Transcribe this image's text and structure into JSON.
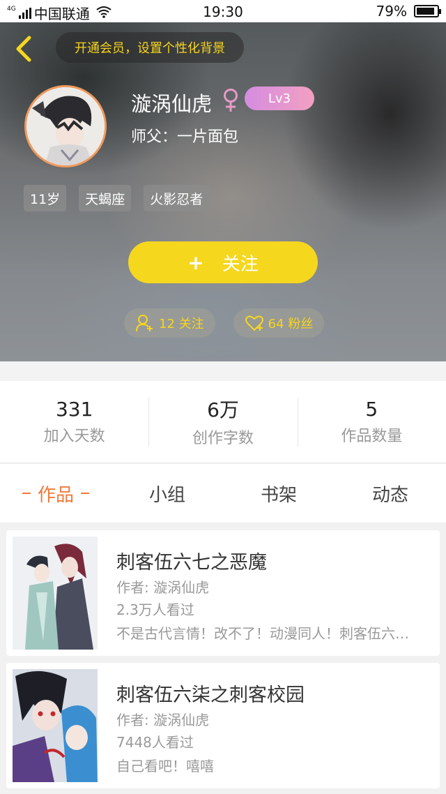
{
  "status_bar": {
    "network": "4G",
    "carrier": "中国联通",
    "time": "19:30",
    "battery": "79%"
  },
  "header": {
    "vip_prompt": "开通会员，设置个性化背景",
    "nickname": "漩涡仙虎",
    "level": "Lv3",
    "master": "师父：一片面包",
    "tags": [
      "11岁",
      "天蝎座",
      "火影忍者"
    ],
    "follow_button": {
      "icon": "+",
      "label": "关注"
    },
    "following": "12 关注",
    "fans": "64 粉丝"
  },
  "stats": [
    {
      "value": "331",
      "label": "加入天数"
    },
    {
      "value": "6万",
      "label": "创作字数"
    },
    {
      "value": "5",
      "label": "作品数量"
    }
  ],
  "tabs": [
    {
      "label": "作品"
    },
    {
      "label": "小组"
    },
    {
      "label": "书架"
    },
    {
      "label": "动态"
    }
  ],
  "works": [
    {
      "title": "刺客伍六七之恶魔",
      "author": "作者: 漩涡仙虎",
      "views": "2.3万人看过",
      "desc": "不是古代言情！改不了！动漫同人！刺客伍六…"
    },
    {
      "title": "刺客伍六柒之刺客校园",
      "author": "作者: 漩涡仙虎",
      "views": "7448人看过",
      "desc": "自己看吧！嘻嘻"
    }
  ],
  "colors": {
    "accent_yellow": "#f5d71e",
    "tab_active": "#f07a3c",
    "avatar_border": "#f09a5c",
    "level_badge": "#e39ad0"
  },
  "icons": [
    "signal-icon",
    "wifi-icon",
    "battery-icon",
    "back-icon",
    "female-icon",
    "user-follow-icon",
    "heart-icon"
  ]
}
